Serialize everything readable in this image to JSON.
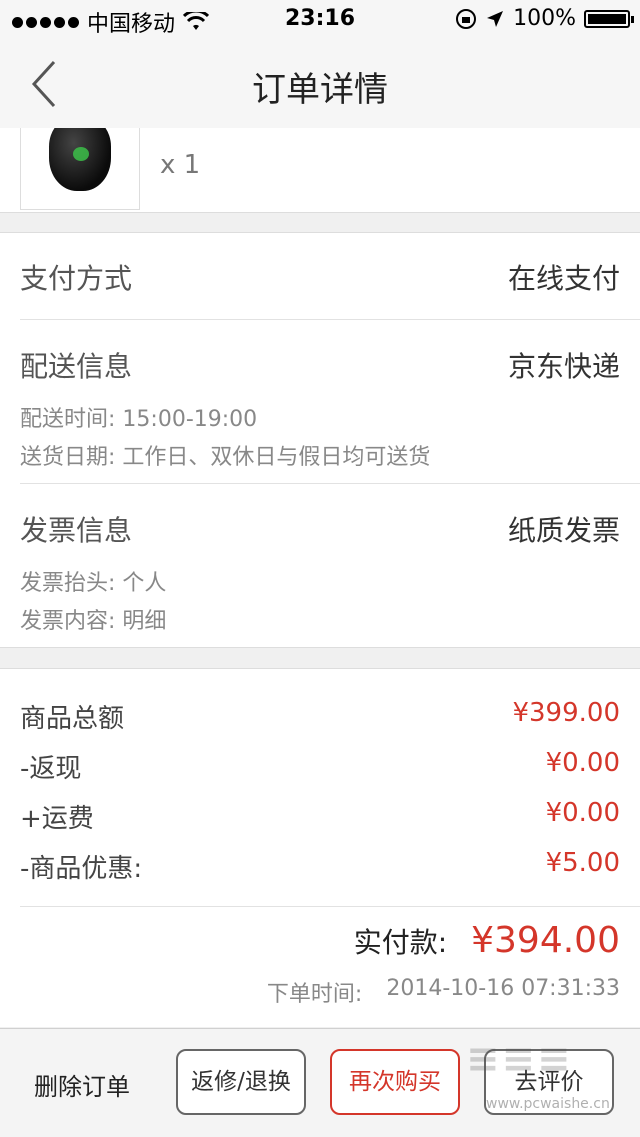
{
  "status_bar": {
    "carrier": "中国移动",
    "time": "23:16",
    "battery_pct": "100%"
  },
  "nav": {
    "title": "订单详情"
  },
  "product": {
    "qty": "x 1"
  },
  "payment": {
    "label": "支付方式",
    "value": "在线支付"
  },
  "delivery": {
    "label": "配送信息",
    "value": "京东快递",
    "time_label": "配送时间:",
    "time_value": "15:00-19:00",
    "date_label": "送货日期:",
    "date_value": "工作日、双休日与假日均可送货"
  },
  "invoice": {
    "label": "发票信息",
    "value": "纸质发票",
    "title_label": "发票抬头:",
    "title_value": "个人",
    "content_label": "发票内容:",
    "content_value": "明细"
  },
  "price": {
    "items": [
      {
        "label": "商品总额",
        "value": "¥399.00"
      },
      {
        "label": "-返现",
        "value": "¥0.00"
      },
      {
        "label": "+运费",
        "value": "¥0.00"
      },
      {
        "label": "-商品优惠:",
        "value": "¥5.00"
      }
    ],
    "total_label": "实付款:",
    "total_value": "¥394.00",
    "order_time_label": "下单时间:",
    "order_time_value": "2014-10-16 07:31:33"
  },
  "actions": {
    "delete": "删除订单",
    "repair": "返修/退换",
    "rebuy": "再次购买",
    "review": "去评价"
  },
  "watermark": {
    "small": "www.pcwaishe.cn"
  },
  "colors": {
    "accent_red": "#d4362a",
    "icon_green": "#3cc84a"
  }
}
